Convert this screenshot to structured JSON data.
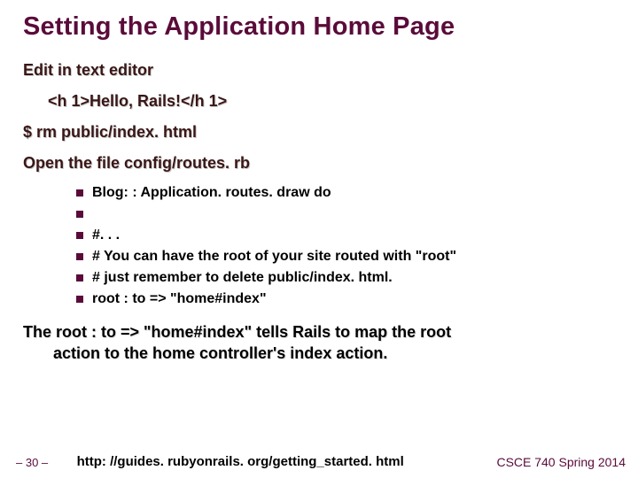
{
  "title": "Setting the Application Home Page",
  "steps": {
    "edit": "Edit in text editor",
    "hello": "<h 1>Hello, Rails!</h 1>",
    "rm": "$ rm public/index. html",
    "open": "Open the file config/routes. rb"
  },
  "bullets": [
    "Blog: : Application. routes. draw do",
    "",
    "#. . .",
    "# You can have the root of your site routed with \"root\"",
    "# just remember to delete public/index. html.",
    "root : to => \"home#index\""
  ],
  "para_line1": "The root : to => \"home#index\" tells Rails to map the root",
  "para_line2": "action to the home controller's index action.",
  "footer": {
    "page": "– 30 –",
    "url": "http: //guides. rubyonrails. org/getting_started. html",
    "course": "CSCE 740 Spring 2014"
  }
}
